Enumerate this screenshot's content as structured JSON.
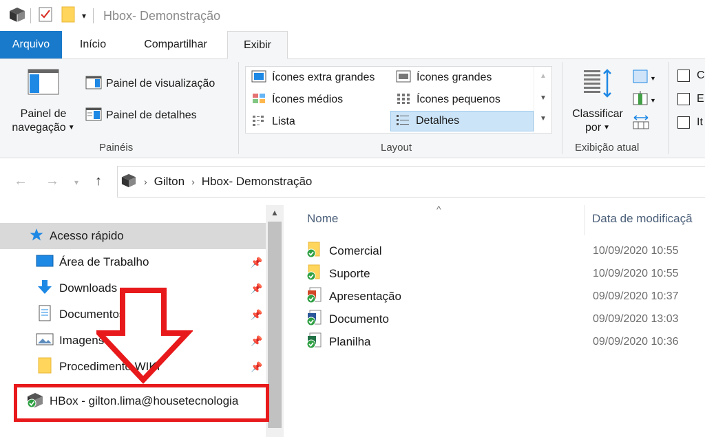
{
  "window": {
    "title": "Hbox- Demonstração"
  },
  "tabs": [
    {
      "label": "Arquivo"
    },
    {
      "label": "Início"
    },
    {
      "label": "Compartilhar"
    },
    {
      "label": "Exibir"
    }
  ],
  "ribbon": {
    "paineis": {
      "label": "Painéis",
      "nav_pane_line1": "Painel de",
      "nav_pane_line2": "navegação",
      "preview_pane": "Painel de visualização",
      "details_pane": "Painel de detalhes"
    },
    "layout": {
      "label": "Layout",
      "items": [
        {
          "label": "Ícones extra grandes"
        },
        {
          "label": "Ícones grandes"
        },
        {
          "label": "Ícones médios"
        },
        {
          "label": "Ícones pequenos"
        },
        {
          "label": "Lista"
        },
        {
          "label": "Detalhes"
        }
      ],
      "selected": "Detalhes"
    },
    "current_view": {
      "label": "Exibição atual",
      "sort_line1": "Classificar",
      "sort_line2": "por"
    },
    "show_hide": {
      "items": [
        {
          "label": "C"
        },
        {
          "label": "E"
        },
        {
          "label": "It"
        }
      ]
    }
  },
  "address": {
    "crumbs": [
      "Gilton",
      "Hbox- Demonstração"
    ]
  },
  "navpane": {
    "items": [
      {
        "label": "Acesso rápido",
        "pinned": false,
        "selected": true
      },
      {
        "label": "Área de Trabalho",
        "pinned": true
      },
      {
        "label": "Downloads",
        "pinned": true
      },
      {
        "label": "Documentos",
        "pinned": true
      },
      {
        "label": "Imagens",
        "pinned": true
      },
      {
        "label": "Procedimento WIKI",
        "pinned": true
      },
      {
        "label": "HBox - gilton.lima@housetecnologia",
        "pinned": false
      }
    ]
  },
  "filelist": {
    "columns": [
      "Nome",
      "Data de modificaçã"
    ],
    "rows": [
      {
        "name": "Comercial",
        "date": "10/09/2020 10:55",
        "type": "folder"
      },
      {
        "name": "Suporte",
        "date": "10/09/2020 10:55",
        "type": "folder"
      },
      {
        "name": "Apresentação",
        "date": "09/09/2020 10:37",
        "type": "pptx"
      },
      {
        "name": "Documento",
        "date": "09/09/2020 13:03",
        "type": "docx"
      },
      {
        "name": "Planilha",
        "date": "09/09/2020 10:36",
        "type": "xlsx"
      }
    ]
  },
  "colors": {
    "file_tab": "#1979ca",
    "selection": "#cce4f7",
    "annotation": "#e8191b",
    "sync_ok": "#2ea043"
  }
}
